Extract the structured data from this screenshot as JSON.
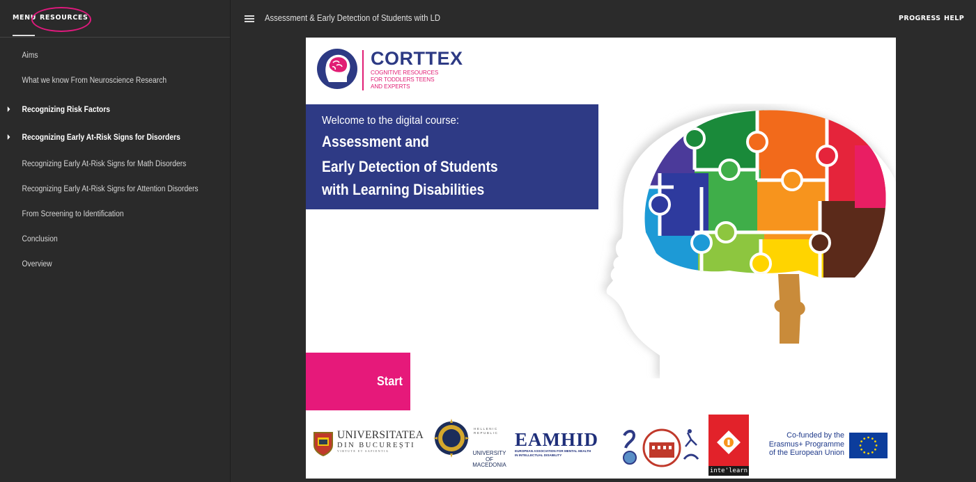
{
  "sidebar": {
    "tabs": {
      "menu": "MENU",
      "resources": "RESOURCES"
    },
    "items": [
      {
        "label": "Aims",
        "expandable": false,
        "strong": false
      },
      {
        "label": "What we know From Neuroscience Research",
        "expandable": false,
        "strong": false
      },
      {
        "label": "Recognizing Risk Factors",
        "expandable": true,
        "strong": true
      },
      {
        "label": "Recognizing Early At-Risk Signs for Disorders",
        "expandable": true,
        "strong": true
      },
      {
        "label": "Recognizing Early At-Risk Signs for Math Disorders",
        "expandable": false,
        "strong": false
      },
      {
        "label": "Recognizing Early At-Risk Signs for Attention Disorders",
        "expandable": false,
        "strong": false
      },
      {
        "label": "From Screening to Identification",
        "expandable": false,
        "strong": false
      },
      {
        "label": "Conclusion",
        "expandable": false,
        "strong": false
      },
      {
        "label": "Overview",
        "expandable": false,
        "strong": false
      }
    ]
  },
  "header": {
    "title": "Assessment & Early Detection of Students with LD",
    "progress_label": "PROGRESS",
    "help_label": "HELP"
  },
  "slide": {
    "logo": {
      "title": "CORTTEX",
      "subtitle_lines": [
        "COGNITIVE RESOURCES",
        "FOR TODDLERS TEENS",
        "AND EXPERTS"
      ]
    },
    "banner": {
      "welcome": "Welcome to the digital course:",
      "title_lines": [
        "Assessment and",
        "Early Detection of Students",
        "with Learning Disabilities"
      ]
    },
    "start_label": "Start",
    "partners": {
      "bucharest": {
        "line1": "UNIVERSITATEA",
        "line2": "DIN BUCUREȘTI",
        "motto": "VIRTUTE ET SAPIENTIA"
      },
      "macedonia": {
        "republic": "HELLENIC REPUBLIC",
        "line1": "UNIVERSITY",
        "line2": "OF MACEDONIA"
      },
      "eamhid": {
        "title": "EAMHID",
        "sub_lines": [
          "EUROPEAN ASSOCIATION FOR MENTAL HEALTH",
          "IN INTELLECTUAL DISABILITY"
        ]
      },
      "intelearn": {
        "label": "inte'learn"
      },
      "eu": {
        "lines": [
          "Co-funded by the",
          "Erasmus+ Programme",
          "of the European Union"
        ]
      }
    }
  },
  "colors": {
    "accent_pink": "#e6197a",
    "banner_navy": "#2e3a85",
    "sidebar_bg": "#2a2a2a",
    "page_bg": "#2b2b2b"
  },
  "icons": {
    "menu": "hamburger-icon",
    "expand": "caret-right-icon",
    "brand": "brain-head-icon"
  }
}
